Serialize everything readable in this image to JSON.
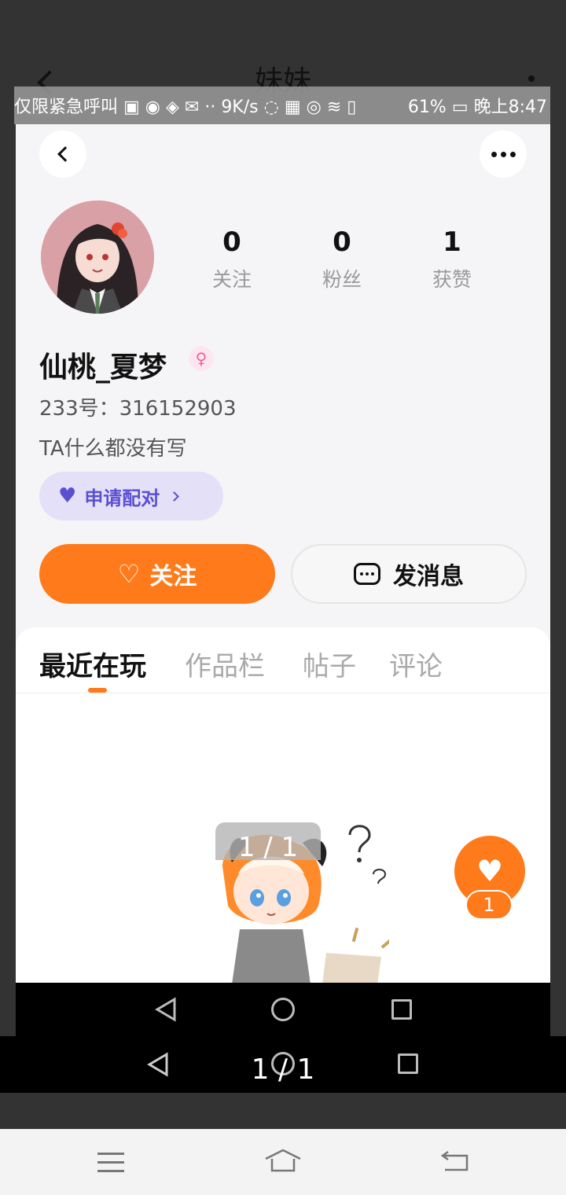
{
  "outer": {
    "title": "妹妹"
  },
  "status_bar": {
    "left_text": "仅限紧急呼叫",
    "speed": "9K/s",
    "battery": "61%",
    "time": "晚上8:47"
  },
  "profile": {
    "stats": [
      {
        "value": "0",
        "label": "关注"
      },
      {
        "value": "0",
        "label": "粉丝"
      },
      {
        "value": "1",
        "label": "获赞"
      }
    ],
    "username": "仙桃_夏梦",
    "gender_symbol": "♀",
    "user_id": "233号：316152903",
    "bio": "TA什么都没有写",
    "pair_button": "申请配对",
    "follow_button": "关注",
    "message_button": "发消息"
  },
  "tabs": [
    {
      "label": "最近在玩",
      "active": true
    },
    {
      "label": "作品栏",
      "active": false
    },
    {
      "label": "帖子",
      "active": false
    },
    {
      "label": "评论",
      "active": false
    }
  ],
  "like_fab": {
    "count": "1"
  },
  "page_indicator": "1 / 1",
  "colors": {
    "accent": "#ff7a1a",
    "pair_bg": "#e3e0f7",
    "pair_text": "#5b4fd1",
    "gender": "#f06292"
  }
}
